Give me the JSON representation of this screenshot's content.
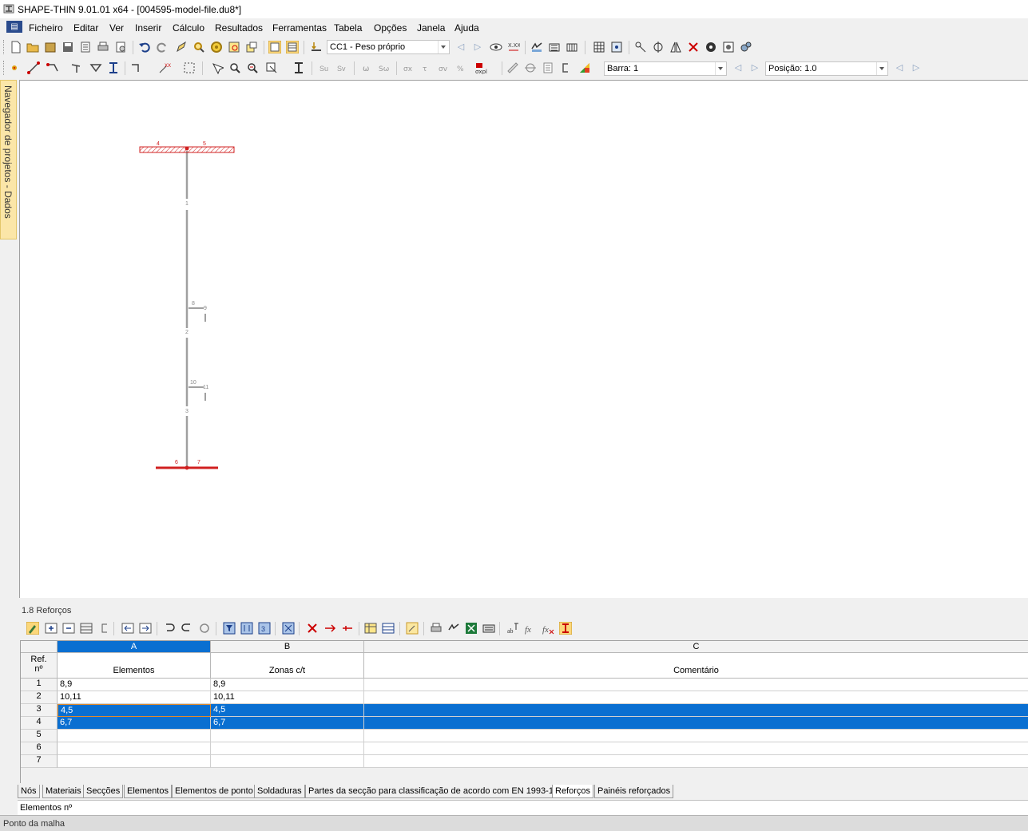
{
  "window": {
    "title": "SHAPE-THIN 9.01.01 x64 - [004595-model-file.du8*]"
  },
  "menu": [
    "Ficheiro",
    "Editar",
    "Ver",
    "Inserir",
    "Cálculo",
    "Resultados",
    "Ferramentas",
    "Tabela",
    "Opções",
    "Janela",
    "Ajuda"
  ],
  "toolbar1": {
    "load_case": "CC1 - Peso próprio"
  },
  "toolbar2": {
    "bar": "Barra: 1",
    "position": "Posição: 1.0"
  },
  "navigator": {
    "label": "Navegador de projetos - Dados"
  },
  "drawing": {
    "element_labels": [
      "1",
      "2",
      "3"
    ],
    "node_labels": [
      "4",
      "5",
      "6",
      "7",
      "8",
      "9",
      "10",
      "11"
    ],
    "colors": {
      "member": "#a0a0a0",
      "flange": "#d02020",
      "label": "#888888"
    }
  },
  "panel": {
    "title": "1.8 Reforços"
  },
  "table": {
    "col_letters": [
      "A",
      "B",
      "C"
    ],
    "ref_header": "Ref.\nnº",
    "col_headers": [
      "Elementos",
      "Zonas c/t",
      "Comentário"
    ],
    "rows": [
      {
        "n": "1",
        "a": "8,9",
        "b": "8,9",
        "c": ""
      },
      {
        "n": "2",
        "a": "10,11",
        "b": "10,11",
        "c": ""
      },
      {
        "n": "3",
        "a": "4,5",
        "b": "4,5",
        "c": ""
      },
      {
        "n": "4",
        "a": "6,7",
        "b": "6,7",
        "c": ""
      },
      {
        "n": "5",
        "a": "",
        "b": "",
        "c": ""
      },
      {
        "n": "6",
        "a": "",
        "b": "",
        "c": ""
      },
      {
        "n": "7",
        "a": "",
        "b": "",
        "c": ""
      }
    ],
    "selection_color": "#0a6fd1"
  },
  "sheet_tabs": [
    "Nós",
    "Materiais",
    "Secções",
    "Elementos",
    "Elementos de ponto",
    "Soldaduras",
    "Partes da secção para classificação de acordo com EN 1993-1",
    "Reforços",
    "Painéis reforçados"
  ],
  "active_tab": "Reforços",
  "field_info": "Elementos nº",
  "status": "Ponto da malha"
}
